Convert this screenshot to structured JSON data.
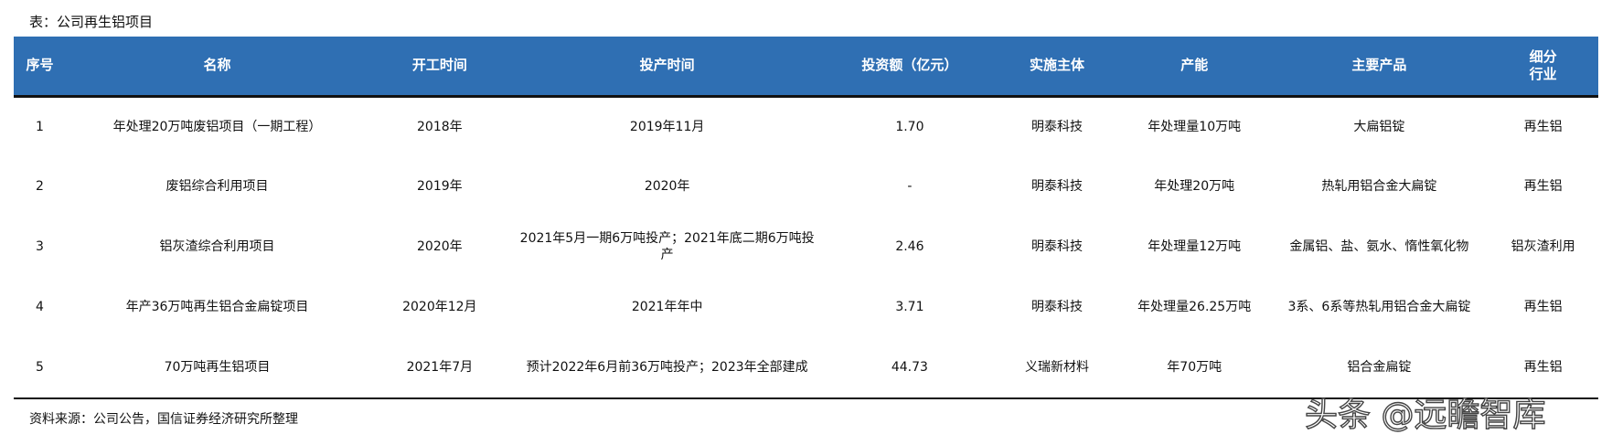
{
  "caption": "表：公司再生铝项目",
  "table": {
    "headers": [
      "序号",
      "名称",
      "开工时间",
      "投产时间",
      "投资额（亿元）",
      "实施主体",
      "产能",
      "主要产品",
      "细分\n行业"
    ],
    "rows": [
      [
        "1",
        "年处理20万吨废铝项目（一期工程）",
        "2018年",
        "2019年11月",
        "1.70",
        "明泰科技",
        "年处理量10万吨",
        "大扁铝锭",
        "再生铝"
      ],
      [
        "2",
        "废铝综合利用项目",
        "2019年",
        "2020年",
        "-",
        "明泰科技",
        "年处理20万吨",
        "热轧用铝合金大扁锭",
        "再生铝"
      ],
      [
        "3",
        "铝灰渣综合利用项目",
        "2020年",
        "2021年5月一期6万吨投产；2021年底二期6万吨投产",
        "2.46",
        "明泰科技",
        "年处理量12万吨",
        "金属铝、盐、氨水、惰性氧化物",
        "铝灰渣利用"
      ],
      [
        "4",
        "年产36万吨再生铝合金扁锭项目",
        "2020年12月",
        "2021年年中",
        "3.71",
        "明泰科技",
        "年处理量26.25万吨",
        "3系、6系等热轧用铝合金大扁锭",
        "再生铝"
      ],
      [
        "5",
        "70万吨再生铝项目",
        "2021年7月",
        "预计2022年6月前36万吨投产；2023年全部建成",
        "44.73",
        "义瑞新材料",
        "年70万吨",
        "铝合金扁锭",
        "再生铝"
      ]
    ]
  },
  "source": "资料来源：公司公告，国信证券经济研究所整理",
  "watermark": "头条 @远瞻智库",
  "colors": {
    "header_bg": "#2f6fb3",
    "header_text": "#ffffff",
    "rule": "#111111"
  }
}
